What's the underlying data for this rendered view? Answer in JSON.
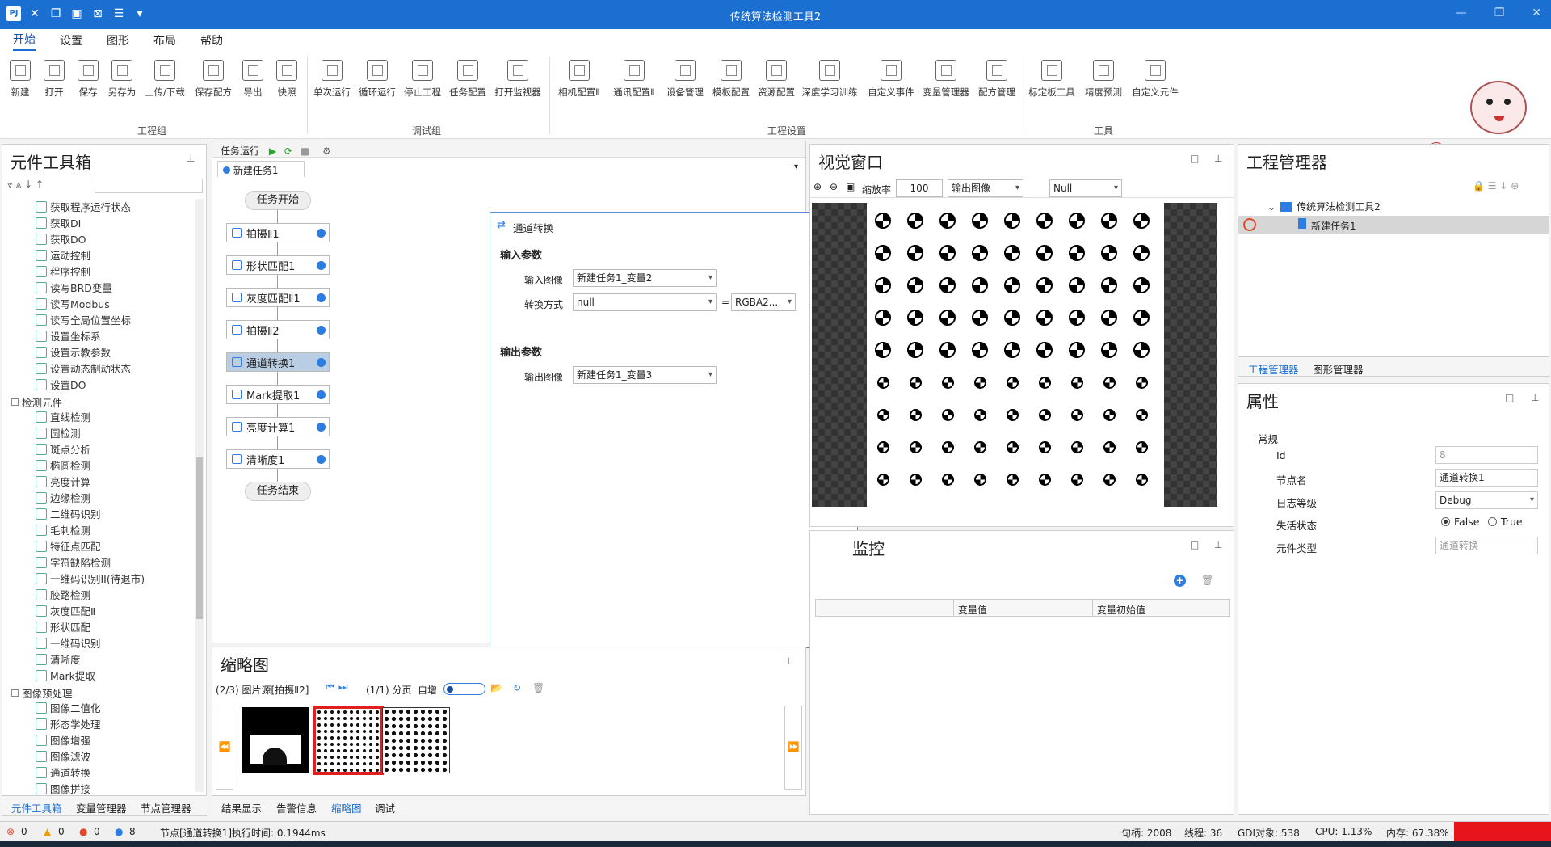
{
  "app": {
    "title": "传统算法检测工具2"
  },
  "menu": [
    "开始",
    "设置",
    "图形",
    "布局",
    "帮助"
  ],
  "ribbon": {
    "groups": [
      {
        "label": "工程组",
        "buttons": [
          "新建",
          "打开",
          "保存",
          "另存为",
          "上传/下载",
          "保存配方",
          "导出",
          "快照"
        ]
      },
      {
        "label": "调试组",
        "buttons": [
          "单次运行",
          "循环运行",
          "停止工程",
          "任务配置",
          "打开监视器"
        ]
      },
      {
        "label": "工程设置",
        "buttons": [
          "相机配置Ⅱ",
          "通讯配置Ⅱ",
          "设备管理",
          "模板配置",
          "资源配置",
          "深度学习训练",
          "自定义事件",
          "变量管理器",
          "配方管理"
        ]
      },
      {
        "label": "工具",
        "buttons": [
          "标定板工具",
          "精度预测",
          "自定义元件"
        ]
      }
    ]
  },
  "toolbox": {
    "title": "元件工具箱",
    "items": [
      "获取程序运行状态",
      "获取DI",
      "获取DO",
      "运动控制",
      "程序控制",
      "读写BRD变量",
      "读写Modbus",
      "读写全局位置坐标",
      "设置坐标系",
      "设置示教参数",
      "设置动态制动状态",
      "设置DO"
    ],
    "cat1": "检测元件",
    "items2": [
      "直线检测",
      "圆检测",
      "斑点分析",
      "椭圆检测",
      "亮度计算",
      "边缘检测",
      "二维码识别",
      "毛刺检测",
      "特征点匹配",
      "字符缺陷检测",
      "一维码识别II(待退市)",
      "胶路检测",
      "灰度匹配Ⅱ",
      "形状匹配",
      "一维码识别",
      "清晰度",
      "Mark提取"
    ],
    "cat2": "图像预处理",
    "items3": [
      "图像二值化",
      "形态学处理",
      "图像增强",
      "图像滤波",
      "通道转换",
      "图像拼接"
    ],
    "tabs": [
      "元件工具箱",
      "变量管理器",
      "节点管理器"
    ]
  },
  "task": {
    "toolbar_label": "任务运行",
    "tab": "新建任务1",
    "start": "任务开始",
    "end": "任务结束",
    "nodes": [
      "拍摄Ⅱ1",
      "形状匹配1",
      "灰度匹配Ⅱ1",
      "拍摄Ⅱ2",
      "通道转换1",
      "Mark提取1",
      "亮度计算1",
      "清晰度1"
    ]
  },
  "dialog": {
    "title": "通道转换",
    "input_section": "输入参数",
    "input_image_label": "输入图像",
    "input_image_value": "新建任务1_变量2",
    "convert_label": "转换方式",
    "convert_value": "null",
    "eq": "=",
    "convert_target": "RGBA2...",
    "output_section": "输出参数",
    "output_image_label": "输出图像",
    "output_image_value": "新建任务1_变量3"
  },
  "thumb": {
    "title": "缩略图",
    "source": "(2/3) 图片源[拍摄Ⅱ2]",
    "page": "(1/1) 分页",
    "auto": "自增",
    "tabs": [
      "结果显示",
      "告警信息",
      "缩略图",
      "调试"
    ]
  },
  "vision": {
    "title": "视觉窗口",
    "zoom_label": "缩放率",
    "zoom_value": "100",
    "output_select": "输出图像",
    "null_select": "Null"
  },
  "monitor": {
    "title": "监控",
    "cols": [
      "变量值",
      "变量初始值"
    ]
  },
  "project": {
    "title": "工程管理器",
    "root": "传统算法检测工具2",
    "child": "新建任务1",
    "tabs": [
      "工程管理器",
      "图形管理器"
    ]
  },
  "props": {
    "title": "属性",
    "section": "常规",
    "id_label": "Id",
    "id_value": "8",
    "name_label": "节点名",
    "name_value": "通道转换1",
    "log_label": "日志等级",
    "log_value": "Debug",
    "act_label": "失活状态",
    "false_label": "False",
    "true_label": "True",
    "type_label": "元件类型",
    "type_value": "通道转换"
  },
  "status": {
    "err": "0",
    "warn": "0",
    "stop": "0",
    "info": "8",
    "message": "节点[通道转换1]执行时间: 0.1944ms",
    "handle": "句柄: 2008",
    "thread": "线程: 36",
    "gdi": "GDI对象: 538",
    "cpu": "CPU: 1.13%",
    "mem": "内存: 67.38%"
  },
  "colors": {
    "accent": "#1a6fd1",
    "selected": "#b9cde5",
    "thumb_sel": "#e02020",
    "status_red": "#e8141c"
  }
}
